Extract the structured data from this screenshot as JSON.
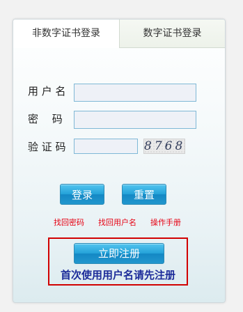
{
  "tabs": [
    {
      "label": "非数字证书登录",
      "active": true
    },
    {
      "label": "数字证书登录",
      "active": false
    }
  ],
  "form": {
    "username_label": "用 户 名",
    "username_value": "",
    "password_label": "密　 码",
    "password_value": "",
    "captcha_label": "验 证 码",
    "captcha_value": "",
    "captcha_image_text": "8768"
  },
  "buttons": {
    "login": "登录",
    "reset": "重置"
  },
  "links": {
    "forgot_password": "找回密码",
    "forgot_username": "找回用户名",
    "manual": "操作手册"
  },
  "register": {
    "button": "立即注册",
    "hint": "首次使用用户名请先注册"
  },
  "colors": {
    "button_blue": "#23a1d8",
    "link_red": "#e60012",
    "hint_blue": "#1d2c9a",
    "highlight_border": "#d10000"
  }
}
